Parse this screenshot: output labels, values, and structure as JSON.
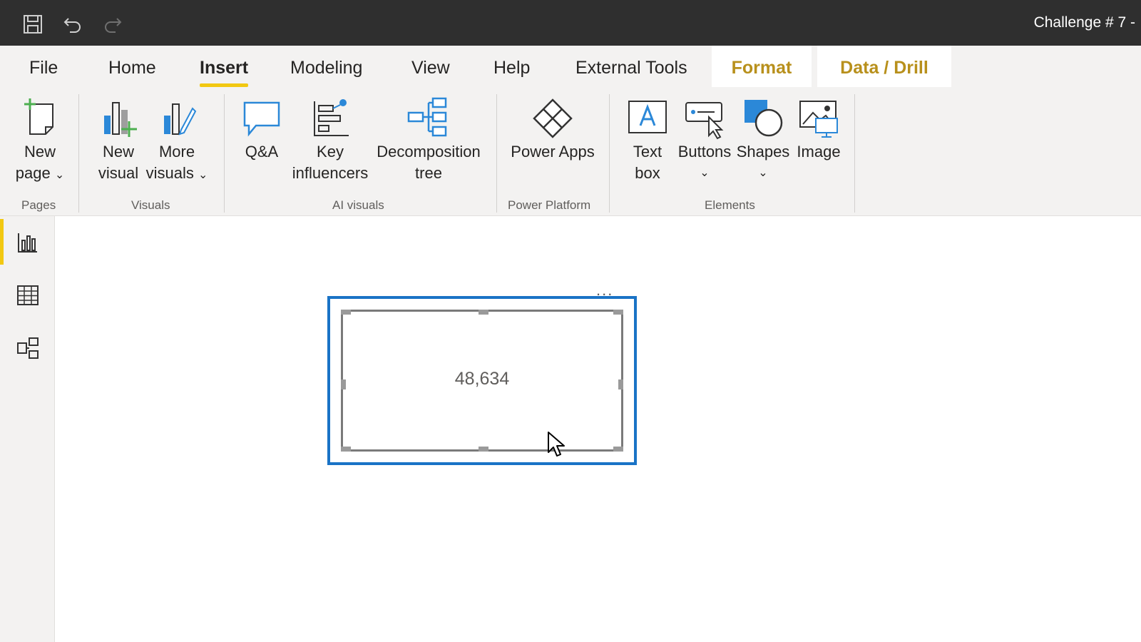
{
  "titlebar": {
    "title": "Challenge # 7 -",
    "icons": [
      "save-icon",
      "undo-icon",
      "redo-icon"
    ]
  },
  "tabs": [
    {
      "label": "File"
    },
    {
      "label": "Home"
    },
    {
      "label": "Insert",
      "active": true
    },
    {
      "label": "Modeling"
    },
    {
      "label": "View"
    },
    {
      "label": "Help"
    },
    {
      "label": "External Tools"
    },
    {
      "label": "Format",
      "contextual": true
    },
    {
      "label": "Data / Drill",
      "contextual": true
    }
  ],
  "ribbon": {
    "groups": {
      "pages": "Pages",
      "visuals": "Visuals",
      "ai_visuals": "AI visuals",
      "power_platform": "Power Platform",
      "elements": "Elements"
    },
    "buttons": {
      "new_page": [
        "New",
        "page"
      ],
      "new_visual": [
        "New",
        "visual"
      ],
      "more_visuals": [
        "More",
        "visuals"
      ],
      "qa": [
        "Q&A"
      ],
      "key_influencers": [
        "Key",
        "influencers"
      ],
      "decomposition_tree": [
        "Decomposition",
        "tree"
      ],
      "power_apps": [
        "Power Apps"
      ],
      "text_box": [
        "Text",
        "box"
      ],
      "buttons": [
        "Buttons"
      ],
      "shapes": [
        "Shapes"
      ],
      "image": [
        "Image"
      ]
    },
    "dropdown_glyph": "⌄"
  },
  "leftnav": {
    "items": [
      "report-icon",
      "data-table-icon",
      "model-icon"
    ]
  },
  "canvas": {
    "card_value": "48,634",
    "more_options": "..."
  },
  "colors": {
    "accent_yellow": "#f2c811",
    "selection_blue": "#1a73c6",
    "icon_blue": "#2b88d8",
    "titlebar": "#2f2f2f",
    "contextual_tab_text": "#b8901c"
  }
}
